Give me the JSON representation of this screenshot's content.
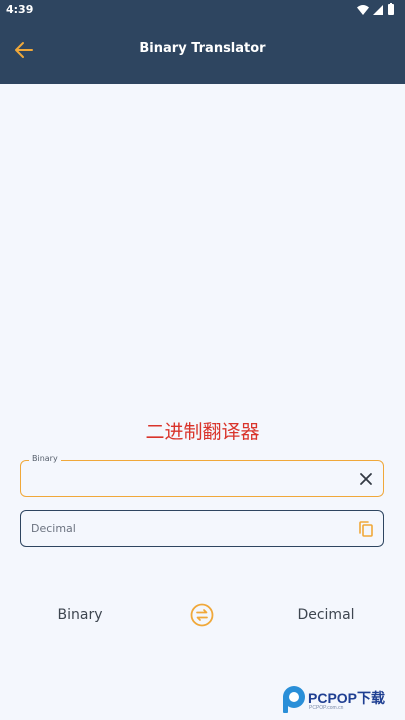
{
  "status_bar": {
    "time": "4:39",
    "icons": [
      "wifi-icon",
      "cellular-signal-icon",
      "battery-icon"
    ]
  },
  "app_bar": {
    "title": "Binary Translator",
    "back_icon": "arrow-left-icon"
  },
  "headline": "二进制翻译器",
  "binary_field": {
    "label": "Binary",
    "value": "",
    "action_icon": "close-icon"
  },
  "decimal_field": {
    "placeholder": "Decimal",
    "value": "",
    "action_icon": "copy-icon"
  },
  "conversion": {
    "from": "Binary",
    "to": "Decimal",
    "swap_icon": "swap-icon"
  },
  "watermark": {
    "brand": "PCPOP下载",
    "tagline": "PCPOP.com.cn"
  },
  "colors": {
    "header": "#2e4560",
    "background": "#f4f7fd",
    "accent": "#f0a83a",
    "headline": "#d9342b"
  }
}
